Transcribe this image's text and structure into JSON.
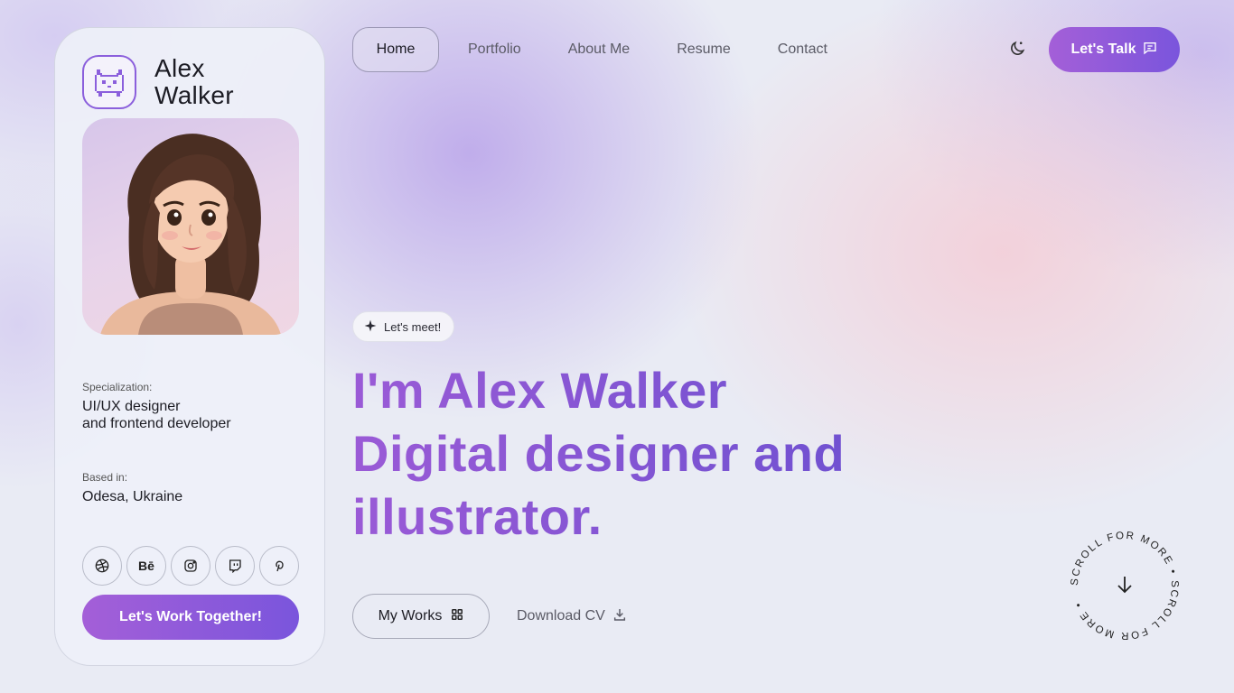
{
  "profile": {
    "name_line1": "Alex",
    "name_line2": "Walker",
    "specialization_label": "Specialization:",
    "specialization_line1": "UI/UX designer",
    "specialization_line2": "and frontend developer",
    "based_label": "Based in:",
    "based_value": "Odesa, Ukraine",
    "socials": [
      "dribbble-icon",
      "behance-icon",
      "instagram-icon",
      "twitch-icon",
      "pinterest-icon"
    ],
    "behance_text": "Bē",
    "cta_label": "Let's Work Together!"
  },
  "nav": {
    "items": [
      {
        "label": "Home",
        "active": true
      },
      {
        "label": "Portfolio",
        "active": false
      },
      {
        "label": "About Me",
        "active": false
      },
      {
        "label": "Resume",
        "active": false
      },
      {
        "label": "Contact",
        "active": false
      }
    ],
    "theme_icon": "moon-icon",
    "talk_label": "Let's Talk"
  },
  "hero": {
    "chip_label": "Let's meet!",
    "headline_line1": "I'm Alex Walker",
    "headline_line2": "Digital designer and",
    "headline_line3": "illustrator.",
    "works_label": "My Works",
    "cv_label": "Download CV",
    "scroll_text": "SCROLL FOR MORE • SCROLL FOR MORE •"
  },
  "colors": {
    "accent_start": "#a45fd8",
    "accent_end": "#7a55dc",
    "background": "#e9ebf4"
  }
}
